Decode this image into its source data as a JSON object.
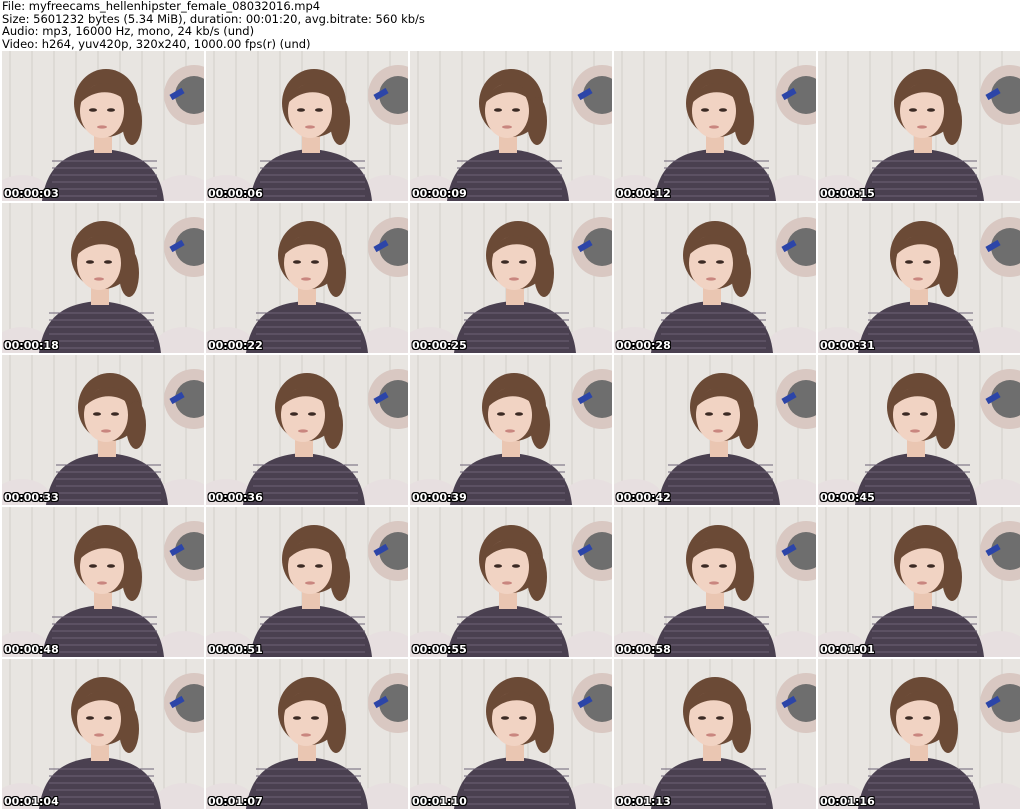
{
  "header": {
    "file_line": "File: myfreecams_hellenhipster_female_08032016.mp4",
    "size_line": "Size: 5601232 bytes (5.34 MiB), duration: 00:01:20, avg.bitrate: 560 kb/s",
    "audio_line": "Audio: mp3, 16000 Hz, mono, 24 kb/s (und)",
    "video_line": "Video: h264, yuv420p, 320x240, 1000.00 fps(r) (und)"
  },
  "thumbnails": [
    {
      "timestamp": "00:00:03"
    },
    {
      "timestamp": "00:00:06"
    },
    {
      "timestamp": "00:00:09"
    },
    {
      "timestamp": "00:00:12"
    },
    {
      "timestamp": "00:00:15"
    },
    {
      "timestamp": "00:00:18"
    },
    {
      "timestamp": "00:00:22"
    },
    {
      "timestamp": "00:00:25"
    },
    {
      "timestamp": "00:00:28"
    },
    {
      "timestamp": "00:00:31"
    },
    {
      "timestamp": "00:00:33"
    },
    {
      "timestamp": "00:00:36"
    },
    {
      "timestamp": "00:00:39"
    },
    {
      "timestamp": "00:00:42"
    },
    {
      "timestamp": "00:00:45"
    },
    {
      "timestamp": "00:00:48"
    },
    {
      "timestamp": "00:00:51"
    },
    {
      "timestamp": "00:00:55"
    },
    {
      "timestamp": "00:00:58"
    },
    {
      "timestamp": "00:01:01"
    },
    {
      "timestamp": "00:01:04"
    },
    {
      "timestamp": "00:01:07"
    },
    {
      "timestamp": "00:01:10"
    },
    {
      "timestamp": "00:01:13"
    },
    {
      "timestamp": "00:01:16"
    }
  ],
  "colors": {
    "background": "#ffffff",
    "wall": "#e8e5e1",
    "shirt": "#4a4050",
    "hair": "#6b4a36",
    "timestamp_text": "#ffffff"
  }
}
